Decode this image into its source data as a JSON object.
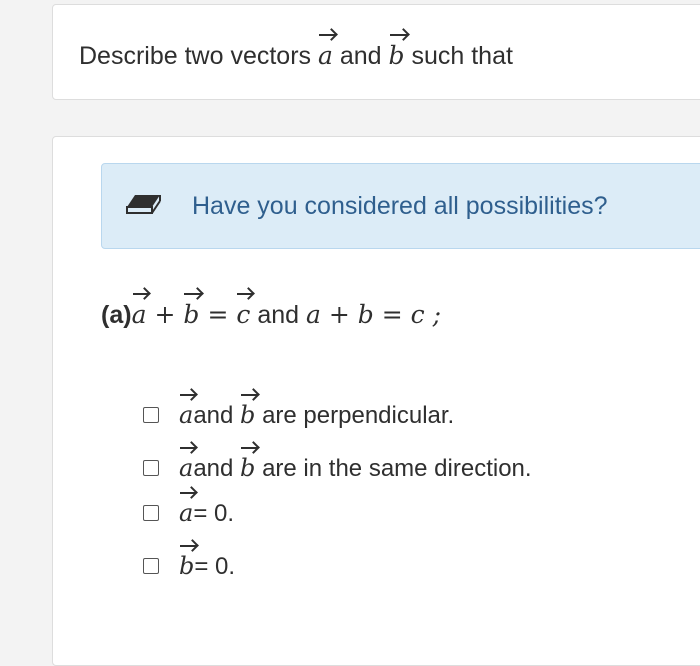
{
  "question": {
    "prefix": "Describe two vectors",
    "vec_a": "a",
    "conj": "and",
    "vec_b": "b",
    "suffix": "such that"
  },
  "hint": {
    "icon": "eraser-icon",
    "text": "Have you considered all possibilities?",
    "color": "#2f5f8e",
    "background": "#dcecf7"
  },
  "part": {
    "label": "(a)",
    "vec_a": "a",
    "plus": "+",
    "vec_b": "b",
    "equals": "=",
    "vec_c": "c",
    "and": "and",
    "scalar_eq": "a + b = c ;"
  },
  "options": [
    {
      "vec": "a",
      "and": "and",
      "vec2": "b",
      "text": "are perpendicular."
    },
    {
      "vec": "a",
      "and": "and",
      "vec2": "b",
      "text": "are in the same direction."
    },
    {
      "vec": "a",
      "text": "= 0."
    },
    {
      "vec": "b",
      "text": "= 0."
    }
  ]
}
